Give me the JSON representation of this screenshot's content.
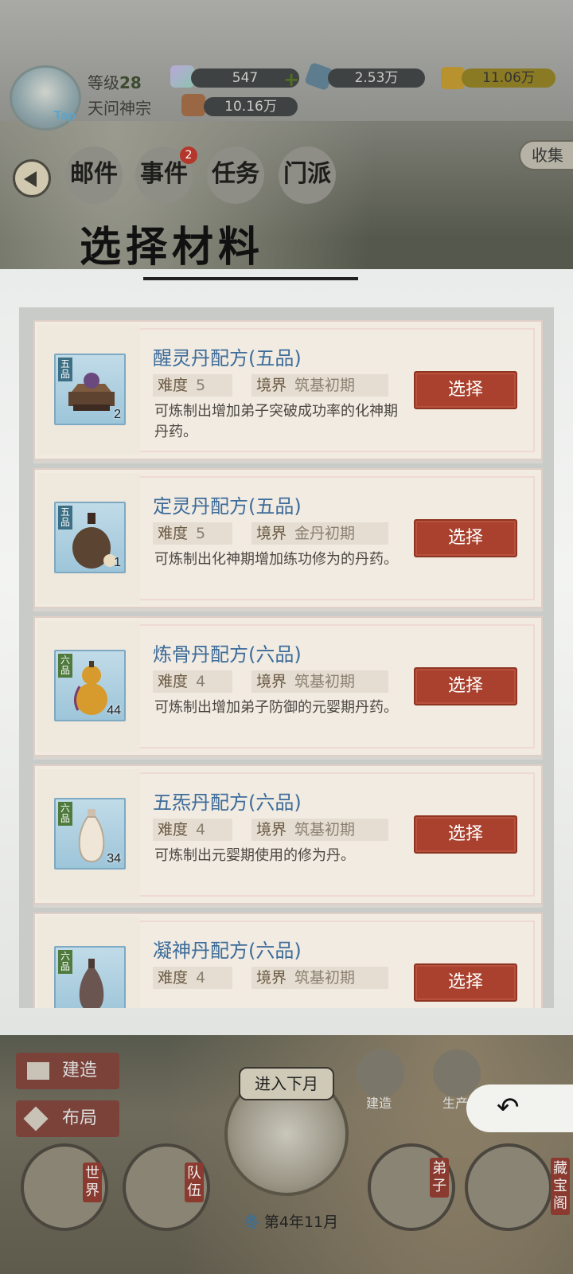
{
  "player": {
    "level_label": "等级",
    "level_value": "28",
    "sect_name": "天问神宗",
    "avatar_tag": "Tap"
  },
  "resources": {
    "spirit_stone": "547",
    "crystal": "2.53万",
    "gold": "11.06万",
    "food": "10.16万"
  },
  "nav": {
    "mail": "邮件",
    "events": "事件",
    "events_badge": "2",
    "tasks": "任务",
    "sect": "门派",
    "collect": "收集"
  },
  "dialog": {
    "title": "选择材料",
    "items": [
      {
        "grade_tag": "五品",
        "name": "醒灵丹配方(五品)",
        "difficulty_label": "难度",
        "difficulty": "5",
        "realm_label": "境界",
        "realm": "筑基初期",
        "desc": "可炼制出增加弟子突破成功率的化神期丹药。",
        "count": "2",
        "button": "选择"
      },
      {
        "grade_tag": "五品",
        "name": "定灵丹配方(五品)",
        "difficulty_label": "难度",
        "difficulty": "5",
        "realm_label": "境界",
        "realm": "金丹初期",
        "desc": "可炼制出化神期增加练功修为的丹药。",
        "count": "1",
        "button": "选择"
      },
      {
        "grade_tag": "六品",
        "name": "炼骨丹配方(六品)",
        "difficulty_label": "难度",
        "difficulty": "4",
        "realm_label": "境界",
        "realm": "筑基初期",
        "desc": "可炼制出增加弟子防御的元婴期丹药。",
        "count": "44",
        "button": "选择"
      },
      {
        "grade_tag": "六品",
        "name": "五炁丹配方(六品)",
        "difficulty_label": "难度",
        "difficulty": "4",
        "realm_label": "境界",
        "realm": "筑基初期",
        "desc": "可炼制出元婴期使用的修为丹。",
        "count": "34",
        "button": "选择"
      },
      {
        "grade_tag": "六品",
        "name": "凝神丹配方(六品)",
        "difficulty_label": "难度",
        "difficulty": "4",
        "realm_label": "境界",
        "realm": "筑基初期",
        "desc": "",
        "count": "",
        "button": "选择"
      }
    ]
  },
  "bottom": {
    "build": "建造",
    "layout": "布局",
    "next_month": "进入下月",
    "build_small": "建造",
    "produce_small": "生产",
    "world": "世界",
    "team": "队伍",
    "disciples": "弟子",
    "treasury": "藏宝阁",
    "season": "冬",
    "date": "第4年11月",
    "back_arrow": "↶"
  }
}
